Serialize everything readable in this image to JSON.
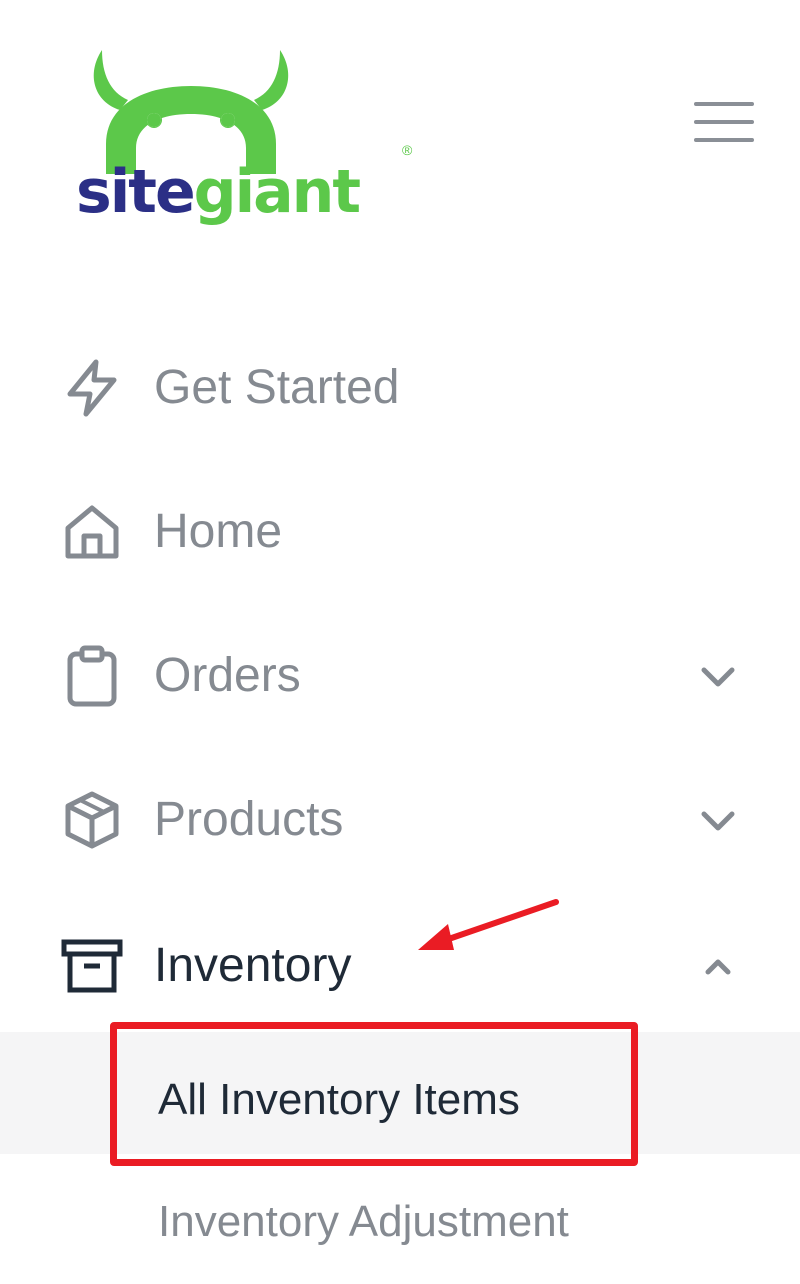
{
  "brand": {
    "name_part1": "site",
    "name_part2": "giant",
    "registered": "®",
    "colors": {
      "dark": "#2b2f86",
      "green": "#5cc84a"
    }
  },
  "menu_toggle": {
    "icon": "hamburger-menu-icon"
  },
  "nav": {
    "items": [
      {
        "label": "Get Started",
        "icon": "lightning-icon",
        "expandable": false
      },
      {
        "label": "Home",
        "icon": "home-icon",
        "expandable": false
      },
      {
        "label": "Orders",
        "icon": "clipboard-icon",
        "expandable": true,
        "expanded": false
      },
      {
        "label": "Products",
        "icon": "box-icon",
        "expandable": true,
        "expanded": false
      },
      {
        "label": "Inventory",
        "icon": "archive-icon",
        "expandable": true,
        "expanded": true
      }
    ],
    "inventory_submenu": [
      {
        "label": "All Inventory Items",
        "active": true
      },
      {
        "label": "Inventory Adjustment",
        "active": false
      }
    ]
  },
  "annotation": {
    "highlight_color": "#ea1c24",
    "arrow_target": "Inventory",
    "box_target": "All Inventory Items"
  },
  "colors": {
    "muted_text": "#858a91",
    "active_text": "#1f2a37",
    "active_bg": "#f5f5f6"
  }
}
